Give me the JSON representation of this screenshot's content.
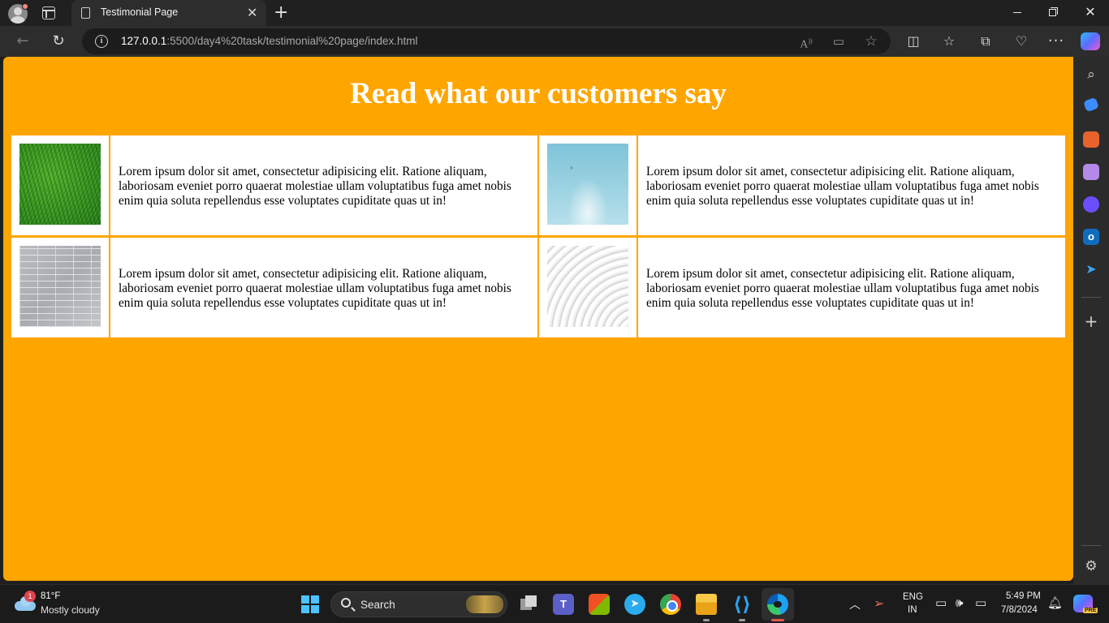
{
  "browser": {
    "tab_title": "Testimonial Page",
    "tab_close": "✕",
    "new_tab": "+",
    "url_host": "127.0.0.1",
    "url_rest": ":5500/day4%20task/testimonial%20page/index.html",
    "icons": [
      "profile-icon",
      "tab-actions-icon",
      "page-icon",
      "back-icon",
      "reload-icon",
      "site-info-icon",
      "read-aloud-icon",
      "immersive-reader-icon",
      "favorite-star-icon",
      "split-screen-icon",
      "favorites-icon",
      "collections-icon",
      "browser-essentials-icon",
      "more-icon",
      "copilot-icon"
    ]
  },
  "sidebar": {
    "icons": [
      "search-icon",
      "shopping-tag-icon",
      "tools-icon",
      "games-icon",
      "copilot-sidebar-icon",
      "outlook-icon",
      "send-icon",
      "add-icon",
      "settings-icon"
    ]
  },
  "page": {
    "background_color": "#ffa500",
    "heading": "Read what our customers say",
    "testimonials": [
      {
        "image": "grass",
        "text": "Lorem ipsum dolor sit amet, consectetur adipisicing elit. Ratione aliquam, laboriosam eveniet porro quaerat molestiae ullam voluptatibus fuga amet nobis enim quia soluta repellendus esse voluptates cupiditate quas ut in!"
      },
      {
        "image": "sky",
        "text": "Lorem ipsum dolor sit amet, consectetur adipisicing elit. Ratione aliquam, laboriosam eveniet porro quaerat molestiae ullam voluptatibus fuga amet nobis enim quia soluta repellendus esse voluptates cupiditate quas ut in!"
      },
      {
        "image": "brick wall",
        "text": "Lorem ipsum dolor sit amet, consectetur adipisicing elit. Ratione aliquam, laboriosam eveniet porro quaerat molestiae ullam voluptatibus fuga amet nobis enim quia soluta repellendus esse voluptates cupiditate quas ut in!"
      },
      {
        "image": "white waves",
        "text": "Lorem ipsum dolor sit amet, consectetur adipisicing elit. Ratione aliquam, laboriosam eveniet porro quaerat molestiae ullam voluptatibus fuga amet nobis enim quia soluta repellendus esse voluptates cupiditate quas ut in!"
      }
    ]
  },
  "taskbar": {
    "weather_badge": "1",
    "weather_temp": "81°F",
    "weather_desc": "Mostly cloudy",
    "search_label": "Search",
    "teams_label": "T",
    "lang_line1": "ENG",
    "lang_line2": "IN",
    "time": "5:49 PM",
    "date": "7/8/2024",
    "copilot_badge": "PRE"
  }
}
